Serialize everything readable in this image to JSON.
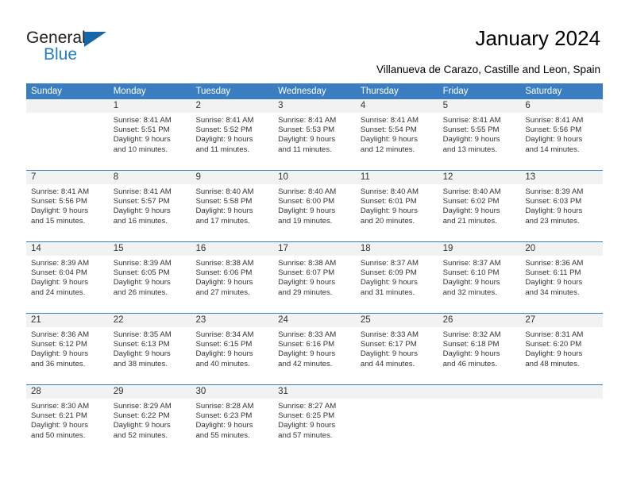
{
  "brand": {
    "name_top": "General",
    "name_bottom": "Blue",
    "triangle_icon": "triangle-icon",
    "color_dark": "#231f20",
    "color_blue": "#1f7fc4"
  },
  "header": {
    "title": "January 2024",
    "subtitle": "Villanueva de Carazo, Castille and Leon, Spain"
  },
  "theme": {
    "header_blue": "#3a7dc0",
    "day_band_gray": "#f2f2f2",
    "text": "#333333"
  },
  "weekdays": [
    "Sunday",
    "Monday",
    "Tuesday",
    "Wednesday",
    "Thursday",
    "Friday",
    "Saturday"
  ],
  "weeks": [
    [
      {
        "day": "",
        "sunrise": "",
        "sunset": "",
        "daylight_1": "",
        "daylight_2": ""
      },
      {
        "day": "1",
        "sunrise": "Sunrise: 8:41 AM",
        "sunset": "Sunset: 5:51 PM",
        "daylight_1": "Daylight: 9 hours",
        "daylight_2": "and 10 minutes."
      },
      {
        "day": "2",
        "sunrise": "Sunrise: 8:41 AM",
        "sunset": "Sunset: 5:52 PM",
        "daylight_1": "Daylight: 9 hours",
        "daylight_2": "and 11 minutes."
      },
      {
        "day": "3",
        "sunrise": "Sunrise: 8:41 AM",
        "sunset": "Sunset: 5:53 PM",
        "daylight_1": "Daylight: 9 hours",
        "daylight_2": "and 11 minutes."
      },
      {
        "day": "4",
        "sunrise": "Sunrise: 8:41 AM",
        "sunset": "Sunset: 5:54 PM",
        "daylight_1": "Daylight: 9 hours",
        "daylight_2": "and 12 minutes."
      },
      {
        "day": "5",
        "sunrise": "Sunrise: 8:41 AM",
        "sunset": "Sunset: 5:55 PM",
        "daylight_1": "Daylight: 9 hours",
        "daylight_2": "and 13 minutes."
      },
      {
        "day": "6",
        "sunrise": "Sunrise: 8:41 AM",
        "sunset": "Sunset: 5:56 PM",
        "daylight_1": "Daylight: 9 hours",
        "daylight_2": "and 14 minutes."
      }
    ],
    [
      {
        "day": "7",
        "sunrise": "Sunrise: 8:41 AM",
        "sunset": "Sunset: 5:56 PM",
        "daylight_1": "Daylight: 9 hours",
        "daylight_2": "and 15 minutes."
      },
      {
        "day": "8",
        "sunrise": "Sunrise: 8:41 AM",
        "sunset": "Sunset: 5:57 PM",
        "daylight_1": "Daylight: 9 hours",
        "daylight_2": "and 16 minutes."
      },
      {
        "day": "9",
        "sunrise": "Sunrise: 8:40 AM",
        "sunset": "Sunset: 5:58 PM",
        "daylight_1": "Daylight: 9 hours",
        "daylight_2": "and 17 minutes."
      },
      {
        "day": "10",
        "sunrise": "Sunrise: 8:40 AM",
        "sunset": "Sunset: 6:00 PM",
        "daylight_1": "Daylight: 9 hours",
        "daylight_2": "and 19 minutes."
      },
      {
        "day": "11",
        "sunrise": "Sunrise: 8:40 AM",
        "sunset": "Sunset: 6:01 PM",
        "daylight_1": "Daylight: 9 hours",
        "daylight_2": "and 20 minutes."
      },
      {
        "day": "12",
        "sunrise": "Sunrise: 8:40 AM",
        "sunset": "Sunset: 6:02 PM",
        "daylight_1": "Daylight: 9 hours",
        "daylight_2": "and 21 minutes."
      },
      {
        "day": "13",
        "sunrise": "Sunrise: 8:39 AM",
        "sunset": "Sunset: 6:03 PM",
        "daylight_1": "Daylight: 9 hours",
        "daylight_2": "and 23 minutes."
      }
    ],
    [
      {
        "day": "14",
        "sunrise": "Sunrise: 8:39 AM",
        "sunset": "Sunset: 6:04 PM",
        "daylight_1": "Daylight: 9 hours",
        "daylight_2": "and 24 minutes."
      },
      {
        "day": "15",
        "sunrise": "Sunrise: 8:39 AM",
        "sunset": "Sunset: 6:05 PM",
        "daylight_1": "Daylight: 9 hours",
        "daylight_2": "and 26 minutes."
      },
      {
        "day": "16",
        "sunrise": "Sunrise: 8:38 AM",
        "sunset": "Sunset: 6:06 PM",
        "daylight_1": "Daylight: 9 hours",
        "daylight_2": "and 27 minutes."
      },
      {
        "day": "17",
        "sunrise": "Sunrise: 8:38 AM",
        "sunset": "Sunset: 6:07 PM",
        "daylight_1": "Daylight: 9 hours",
        "daylight_2": "and 29 minutes."
      },
      {
        "day": "18",
        "sunrise": "Sunrise: 8:37 AM",
        "sunset": "Sunset: 6:09 PM",
        "daylight_1": "Daylight: 9 hours",
        "daylight_2": "and 31 minutes."
      },
      {
        "day": "19",
        "sunrise": "Sunrise: 8:37 AM",
        "sunset": "Sunset: 6:10 PM",
        "daylight_1": "Daylight: 9 hours",
        "daylight_2": "and 32 minutes."
      },
      {
        "day": "20",
        "sunrise": "Sunrise: 8:36 AM",
        "sunset": "Sunset: 6:11 PM",
        "daylight_1": "Daylight: 9 hours",
        "daylight_2": "and 34 minutes."
      }
    ],
    [
      {
        "day": "21",
        "sunrise": "Sunrise: 8:36 AM",
        "sunset": "Sunset: 6:12 PM",
        "daylight_1": "Daylight: 9 hours",
        "daylight_2": "and 36 minutes."
      },
      {
        "day": "22",
        "sunrise": "Sunrise: 8:35 AM",
        "sunset": "Sunset: 6:13 PM",
        "daylight_1": "Daylight: 9 hours",
        "daylight_2": "and 38 minutes."
      },
      {
        "day": "23",
        "sunrise": "Sunrise: 8:34 AM",
        "sunset": "Sunset: 6:15 PM",
        "daylight_1": "Daylight: 9 hours",
        "daylight_2": "and 40 minutes."
      },
      {
        "day": "24",
        "sunrise": "Sunrise: 8:33 AM",
        "sunset": "Sunset: 6:16 PM",
        "daylight_1": "Daylight: 9 hours",
        "daylight_2": "and 42 minutes."
      },
      {
        "day": "25",
        "sunrise": "Sunrise: 8:33 AM",
        "sunset": "Sunset: 6:17 PM",
        "daylight_1": "Daylight: 9 hours",
        "daylight_2": "and 44 minutes."
      },
      {
        "day": "26",
        "sunrise": "Sunrise: 8:32 AM",
        "sunset": "Sunset: 6:18 PM",
        "daylight_1": "Daylight: 9 hours",
        "daylight_2": "and 46 minutes."
      },
      {
        "day": "27",
        "sunrise": "Sunrise: 8:31 AM",
        "sunset": "Sunset: 6:20 PM",
        "daylight_1": "Daylight: 9 hours",
        "daylight_2": "and 48 minutes."
      }
    ],
    [
      {
        "day": "28",
        "sunrise": "Sunrise: 8:30 AM",
        "sunset": "Sunset: 6:21 PM",
        "daylight_1": "Daylight: 9 hours",
        "daylight_2": "and 50 minutes."
      },
      {
        "day": "29",
        "sunrise": "Sunrise: 8:29 AM",
        "sunset": "Sunset: 6:22 PM",
        "daylight_1": "Daylight: 9 hours",
        "daylight_2": "and 52 minutes."
      },
      {
        "day": "30",
        "sunrise": "Sunrise: 8:28 AM",
        "sunset": "Sunset: 6:23 PM",
        "daylight_1": "Daylight: 9 hours",
        "daylight_2": "and 55 minutes."
      },
      {
        "day": "31",
        "sunrise": "Sunrise: 8:27 AM",
        "sunset": "Sunset: 6:25 PM",
        "daylight_1": "Daylight: 9 hours",
        "daylight_2": "and 57 minutes."
      },
      {
        "day": "",
        "sunrise": "",
        "sunset": "",
        "daylight_1": "",
        "daylight_2": ""
      },
      {
        "day": "",
        "sunrise": "",
        "sunset": "",
        "daylight_1": "",
        "daylight_2": ""
      },
      {
        "day": "",
        "sunrise": "",
        "sunset": "",
        "daylight_1": "",
        "daylight_2": ""
      }
    ]
  ]
}
